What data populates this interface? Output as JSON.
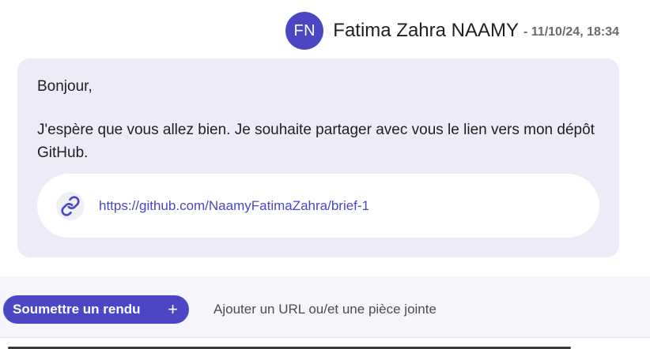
{
  "message": {
    "author": {
      "initials": "FN",
      "name": "Fatima Zahra NAAMY"
    },
    "date": "- 11/10/24, 18:34",
    "greeting": "Bonjour,",
    "body": "J'espère que vous allez bien. Je souhaite partager avec vous le lien vers mon dépôt GitHub.",
    "link": {
      "icon": "link-icon",
      "url": "https://github.com/NaamyFatimaZahra/brief-1"
    }
  },
  "submission": {
    "button_label": "Soumettre un rendu",
    "button_icon": "plus-icon",
    "hint": "Ajouter un URL ou/et une pièce jointe"
  },
  "colors": {
    "accent": "#4a46c4",
    "bubble_bg": "#ececf8",
    "bar_bg": "#f5f5fb"
  }
}
